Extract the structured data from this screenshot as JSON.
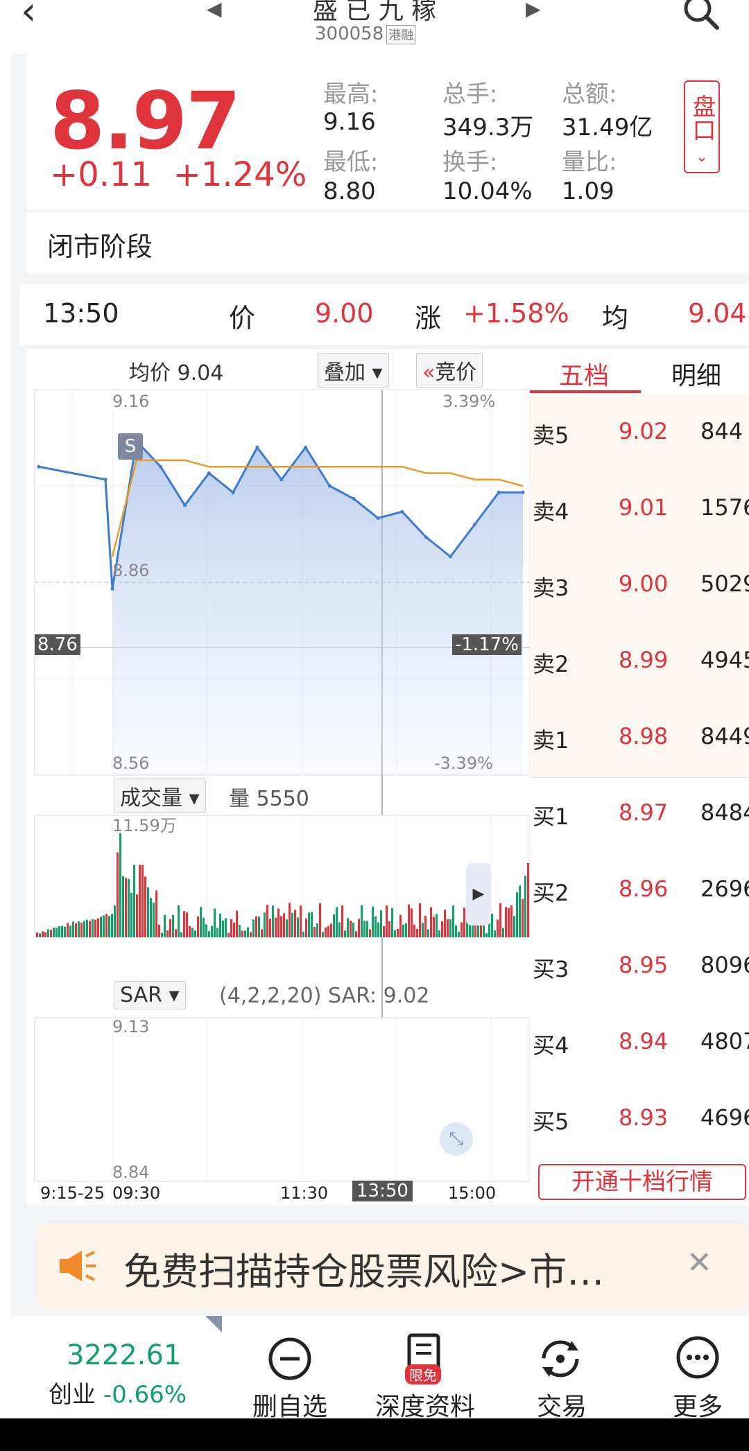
{
  "header": {
    "title": "盛 已 九 稼",
    "code": "300058",
    "tag": "港融"
  },
  "quote": {
    "price": "8.97",
    "change": "+0.11",
    "change_pct": "+1.24%",
    "high_label": "最高:",
    "high": "9.16",
    "low_label": "最低:",
    "low": "8.80",
    "vol_label": "总手:",
    "vol": "349.3万",
    "turnover_label": "换手:",
    "turnover": "10.04%",
    "amount_label": "总额:",
    "amount": "31.49亿",
    "ratio_label": "量比:",
    "ratio": "1.09",
    "pankou_label": "盘口"
  },
  "phase": "闭市阶段",
  "tick": {
    "time": "13:50",
    "price_label": "价",
    "price": "9.00",
    "chg_label": "涨",
    "chg": "+1.58%",
    "avg_label": "均",
    "avg": "9.04"
  },
  "chart": {
    "avg_label": "均价 9.04",
    "overlay_dd": "叠加",
    "auction_btn": "竞价",
    "top_price": "9.16",
    "top_pct": "3.39%",
    "mid_price": "8.86",
    "ref_price": "8.76",
    "ref_pct": "-1.17%",
    "bot_price": "8.56",
    "bot_pct": "-3.39%",
    "s_marker": "S",
    "vol_dd": "成交量",
    "vol_info": "量 5550",
    "vol_max": "11.59万",
    "sar_dd": "SAR",
    "sar_info": "(4,2,2,20) SAR: 9.02",
    "sar_top": "9.13",
    "sar_bot": "8.84",
    "x_labels": [
      "9:15-25",
      "09:30",
      "11:30",
      "13:50",
      "15:00"
    ]
  },
  "chart_data": {
    "type": "line",
    "title": "",
    "xlabel": "",
    "ylabel": "",
    "ylim": [
      8.56,
      9.16
    ],
    "x": [
      "09:15",
      "09:25",
      "09:30",
      "09:45",
      "10:00",
      "10:15",
      "10:30",
      "10:45",
      "11:00",
      "11:15",
      "11:30",
      "13:15",
      "13:30",
      "13:45",
      "13:50",
      "14:00",
      "14:15",
      "14:30",
      "14:45",
      "15:00"
    ],
    "series": [
      {
        "values": [
          9.04,
          9.02,
          8.85,
          9.08,
          9.04,
          8.98,
          9.03,
          9.0,
          9.07,
          9.02,
          9.07,
          9.01,
          8.99,
          8.96,
          8.97,
          8.93,
          8.9,
          8.95,
          9.0,
          9.0
        ]
      },
      {
        "values": [
          null,
          null,
          8.9,
          9.05,
          9.05,
          9.05,
          9.04,
          9.04,
          9.04,
          9.04,
          9.04,
          9.04,
          9.04,
          9.04,
          9.04,
          9.03,
          9.03,
          9.02,
          9.02,
          9.01
        ]
      }
    ]
  },
  "book": {
    "tab1": "五档",
    "tab2": "明细",
    "asks": [
      {
        "side": "卖5",
        "price": "9.02",
        "vol": "844"
      },
      {
        "side": "卖4",
        "price": "9.01",
        "vol": "1576"
      },
      {
        "side": "卖3",
        "price": "9.00",
        "vol": "5029"
      },
      {
        "side": "卖2",
        "price": "8.99",
        "vol": "4945"
      },
      {
        "side": "卖1",
        "price": "8.98",
        "vol": "8449"
      }
    ],
    "bids": [
      {
        "side": "买1",
        "price": "8.97",
        "vol": "8484"
      },
      {
        "side": "买2",
        "price": "8.96",
        "vol": "2696"
      },
      {
        "side": "买3",
        "price": "8.95",
        "vol": "8096"
      },
      {
        "side": "买4",
        "price": "8.94",
        "vol": "4807"
      },
      {
        "side": "买5",
        "price": "8.93",
        "vol": "4696"
      }
    ],
    "open_btn": "开通十档行情"
  },
  "banner": {
    "text": "免费扫描持仓股票风险>市…"
  },
  "bottom": {
    "index_value": "3222.61",
    "index_name": "创业",
    "index_chg": "-0.66%",
    "btn1": "删自选",
    "btn2": "深度资料",
    "btn2_badge": "限免",
    "btn3": "交易",
    "btn4": "更多"
  },
  "colors": {
    "up": "#e0343c",
    "down": "#14a06b",
    "line": "#3b7bd1",
    "avg": "#e89a2a"
  }
}
